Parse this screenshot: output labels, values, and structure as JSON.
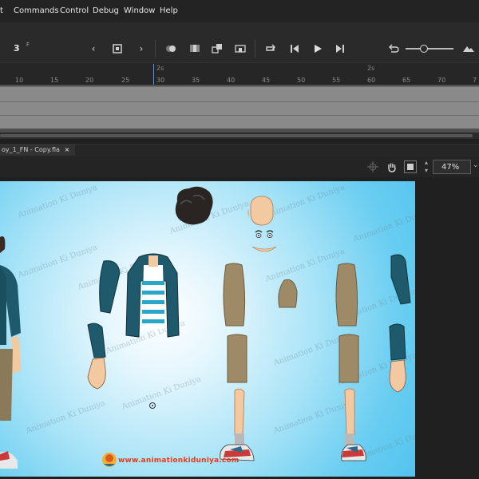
{
  "menu": {
    "items": [
      "t",
      "Commands",
      "Control",
      "Debug",
      "Window",
      "Help"
    ]
  },
  "toolbar": {
    "frame_number": "3",
    "frame_suffix": "F"
  },
  "timeline": {
    "sec_labels": [
      "2s",
      "2s"
    ],
    "ruler_numbers": [
      "10",
      "15",
      "20",
      "25",
      "30",
      "35",
      "40",
      "45",
      "50",
      "55",
      "60",
      "65",
      "70",
      "7"
    ]
  },
  "document": {
    "tab_label": "oy_1_FN - Copy.fla",
    "tab_close": "×"
  },
  "stage": {
    "zoom": "47%"
  },
  "canvas": {
    "watermark": "Animation Ki Duniya",
    "website": "www.animationkiduniya.com",
    "background_colors": [
      "#ffffff",
      "#53c3ee"
    ]
  }
}
